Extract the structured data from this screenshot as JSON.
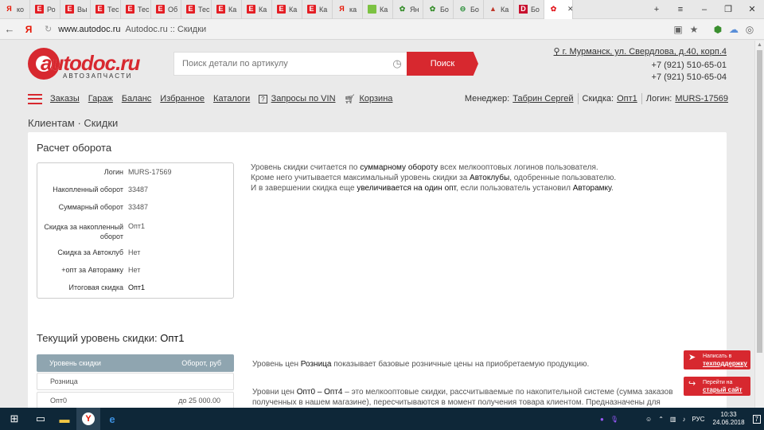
{
  "browser": {
    "tabs": [
      {
        "icon": "yandex",
        "label": "ко"
      },
      {
        "icon": "exist",
        "label": "Ро"
      },
      {
        "icon": "exist",
        "label": "Вы"
      },
      {
        "icon": "exist",
        "label": "Тес"
      },
      {
        "icon": "exist",
        "label": "Тес"
      },
      {
        "icon": "exist",
        "label": "Об"
      },
      {
        "icon": "exist",
        "label": "Тес"
      },
      {
        "icon": "exist",
        "label": "Ка"
      },
      {
        "icon": "exist",
        "label": "Ка"
      },
      {
        "icon": "exist",
        "label": "Ка"
      },
      {
        "icon": "exist",
        "label": "Ка"
      },
      {
        "icon": "yandex",
        "label": "ка"
      },
      {
        "icon": "grid",
        "label": "Ка"
      },
      {
        "icon": "sprout",
        "label": "Ян"
      },
      {
        "icon": "sprout",
        "label": "Бо"
      },
      {
        "icon": "bus",
        "label": "Бо"
      },
      {
        "icon": "drop",
        "label": "Ка"
      },
      {
        "icon": "d",
        "label": "Бо"
      },
      {
        "icon": "autodoc",
        "label": "",
        "active": true
      }
    ],
    "url_host": "www.autodoc.ru",
    "url_title": "Autodoc.ru :: Скидки",
    "back_icon": "back-arrow-icon",
    "yandex_icon": "Я"
  },
  "header": {
    "logo_text": "autodoc",
    "logo_ru": ".ru",
    "logo_sub": "АВТОЗАПЧАСТИ",
    "search_placeholder": "Поиск детали по артикулу",
    "search_button": "Поиск",
    "address": "г. Мурманск, ул. Свердлова, д.40, корп.4",
    "phone1": "+7 (921) 510-65-01",
    "phone2": "+7 (921) 510-65-04"
  },
  "menu": {
    "items": [
      "Заказы",
      "Гараж",
      "Баланс",
      "Избранное",
      "Каталоги"
    ],
    "vin": "Запросы по VIN",
    "cart": "Корзина",
    "manager_label": "Менеджер:",
    "manager_name": "Табрин Сергей",
    "discount_label": "Скидка:",
    "discount_value": "Опт1",
    "login_label": "Логин:",
    "login_value": "MURS-17569"
  },
  "breadcrumb": {
    "part1": "Клиентам",
    "sep": "·",
    "part2": "Скидки"
  },
  "calc": {
    "title": "Расчет оборота",
    "rows": [
      {
        "k": "Логин",
        "v": "MURS-17569"
      },
      {
        "k": "Накопленный оборот",
        "v": "33487"
      },
      {
        "k": "Суммарный оборот",
        "v": "33487"
      },
      {
        "k": "Скидка за накопленный оборот",
        "v": "Опт1"
      },
      {
        "k": "Скидка за Автоклуб",
        "v": "Нет"
      },
      {
        "k": "+опт за Авторамку",
        "v": "Нет"
      },
      {
        "k": "Итоговая скидка",
        "v": "Опт1"
      }
    ],
    "desc": {
      "l1a": "Уровень скидки считается по ",
      "l1b": "суммарному обороту",
      "l1c": " всех мелкооптовых логинов пользователя.",
      "l2a": "Кроме него учитывается максимальный уровень скидки за ",
      "l2b": "Автоклубы",
      "l2c": ", одобренные пользователю.",
      "l3a": "И в завершении скидка еще ",
      "l3b": "увеличивается на один опт",
      "l3c": ", если пользователь установил ",
      "l3d": "Авторамку",
      "l3e": "."
    }
  },
  "level": {
    "title": "Текущий уровень скидки:",
    "value": "Опт1",
    "col1": "Уровень скидки",
    "col2": "Оборот, руб",
    "rows": [
      {
        "name": "Розница",
        "turnover": ""
      },
      {
        "name": "Опт0",
        "turnover": "до 25 000.00"
      }
    ],
    "p1a": "Уровень цен ",
    "p1b": "Розница",
    "p1c": " показывает базовые розничные цены на приобретаемую продукцию.",
    "p2a": "Уровни цен ",
    "p2b": "Опт0 – Опт4",
    "p2c": " – это мелкооптовые скидки, рассчитываемые по накопительной системе (сумма заказов",
    "p2d": "полученных в нашем магазине), пересчитываются в момент получения товара клиентом. Предназначены для"
  },
  "support": {
    "b1_top": "Написать в",
    "b1_bottom": "техподдержку",
    "b2_top": "Перейти на",
    "b2_bottom": "старый сайт"
  },
  "taskbar": {
    "lang": "РУС",
    "time": "10:33",
    "date": "24.06.2018",
    "notif": "7"
  }
}
